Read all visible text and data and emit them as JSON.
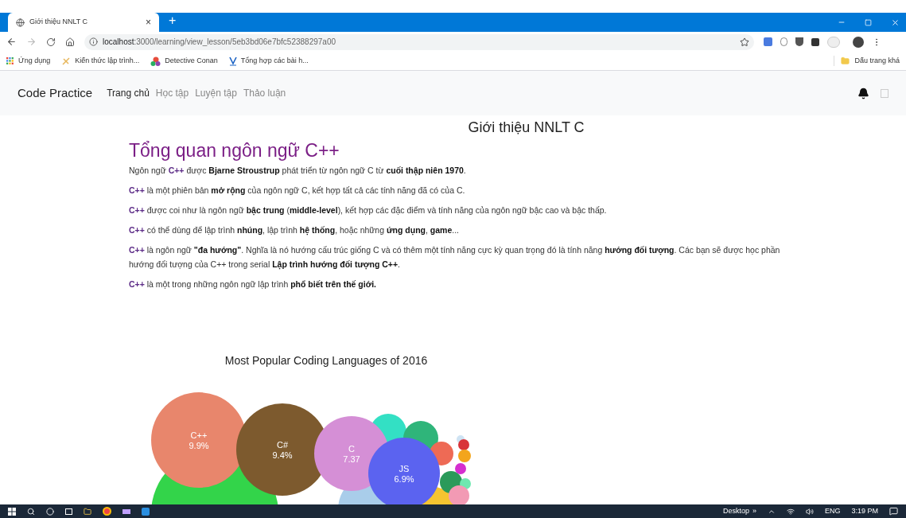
{
  "browser": {
    "tab": {
      "title": "Giới thiệu NNLT C",
      "close": "×",
      "new_tab": "+"
    },
    "url": {
      "host": "localhost",
      "path": ":3000/learning/view_lesson/5eb3bd06e7bfc52388297a00"
    },
    "bookmarks": [
      {
        "label": "Ứng dụng",
        "kind": "apps"
      },
      {
        "label": "Kiến thức lập trình...",
        "kind": "link"
      },
      {
        "label": "Detective Conan",
        "kind": "balls"
      },
      {
        "label": "Tổng hợp các bài h...",
        "kind": "v"
      }
    ],
    "other_bookmarks": "Dấu trang khá"
  },
  "navbar": {
    "brand": "Code Practice",
    "items": [
      {
        "label": "Trang chủ",
        "selected": true
      },
      {
        "label": "Học tập",
        "selected": false
      },
      {
        "label": "Luyện tập",
        "selected": false
      },
      {
        "label": "Thảo luận",
        "selected": false
      }
    ],
    "checkbox": {
      "checked": false
    }
  },
  "page": {
    "title": "Giới thiệu NNLT C",
    "heading": "Tổng quan ngôn ngữ C++",
    "paragraphs": [
      "Ngôn ngữ **C++** được **Bjarne Stroustrup** phát triển từ ngôn ngữ C từ **cuối thập niên 1970**.",
      "**C++** là một phiên bản **mở rộng** của ngôn ngữ C, kết hợp tất cả các tính năng đã có của C.",
      "**C++** được coi như là ngôn ngữ **bậc trung** (**middle-level**), kết hợp các đặc điểm và tính năng của ngôn ngữ bậc cao và bậc thấp.",
      "**C++** có thể dùng để lập trình **nhúng**, lập trình **hệ thống**, hoặc những **ứng dụng**, **game**...",
      "**C++** là ngôn ngữ **\"đa hướng\"**. Nghĩa là nó hướng cấu trúc giống C và có thêm một tính năng cực kỳ quan trọng đó là tính năng **hướng đối tượng**. Các bạn sẽ được học phần hướng đối tượng của C++ trong serial **Lập trình hướng đối tượng C++**.",
      "**C++** là một trong những ngôn ngữ lập trình **phổ biết trên thế giới.**"
    ],
    "chart": {
      "title": "Most Popular Coding Languages of 2016",
      "bubbles": [
        {
          "label": "C++",
          "value": "9.9%",
          "color": "#e8866c"
        },
        {
          "label": "C#",
          "value": "9.4%",
          "color": "#7d5a2e"
        },
        {
          "label": "C",
          "value": "7.37",
          "color": "#d58fd6"
        },
        {
          "label": "JS",
          "value": "6.9%",
          "color": "#5b63f0"
        }
      ]
    }
  },
  "taskbar": {
    "desktop": "Desktop",
    "chevron": "»",
    "language": "ENG",
    "time": "3:19 PM"
  }
}
